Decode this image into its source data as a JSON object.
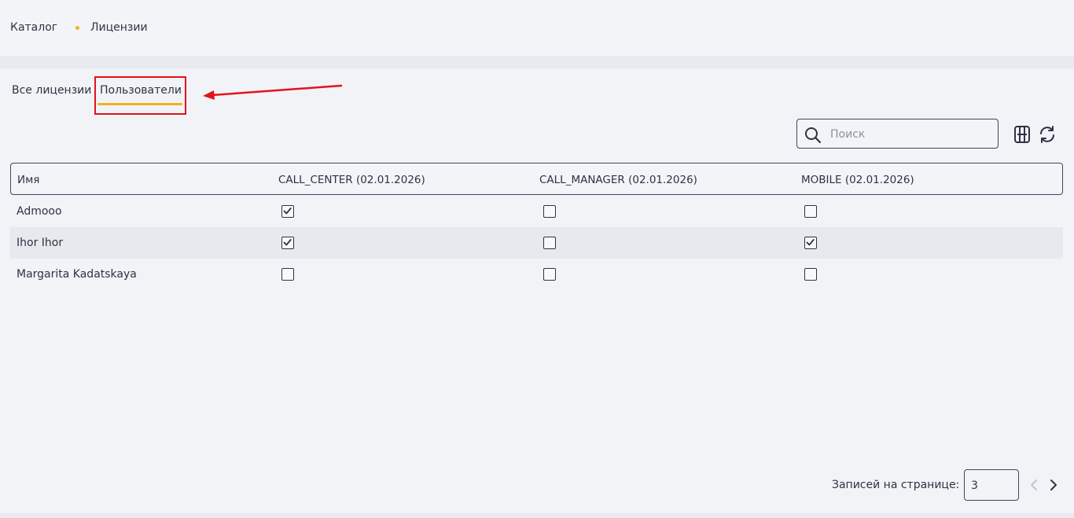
{
  "breadcrumb": {
    "items": [
      "Каталог",
      "Лицензии"
    ]
  },
  "tabs": [
    {
      "label": "Все лицензии",
      "active": false
    },
    {
      "label": "Пользователи",
      "active": true
    }
  ],
  "search": {
    "placeholder": "Поиск",
    "value": ""
  },
  "table": {
    "columns": [
      "Имя",
      "CALL_CENTER (02.01.2026)",
      "CALL_MANAGER (02.01.2026)",
      "MOBILE (02.01.2026)"
    ],
    "rows": [
      {
        "name": "Admooo",
        "checks": [
          true,
          false,
          false
        ]
      },
      {
        "name": "Ihor Ihor",
        "checks": [
          true,
          false,
          true
        ]
      },
      {
        "name": "Margarita Kadatskaya",
        "checks": [
          false,
          false,
          false
        ]
      }
    ]
  },
  "pagination": {
    "label": "Записей на странице:",
    "page_size": "3"
  },
  "colors": {
    "accent": "#f2b21c",
    "annotation": "#e3121b",
    "text": "#2c3345",
    "border": "#3e4660"
  },
  "icons": [
    "search-icon",
    "column-settings-icon",
    "refresh-icon",
    "chevron-left-icon",
    "chevron-right-icon",
    "checkmark-icon"
  ]
}
